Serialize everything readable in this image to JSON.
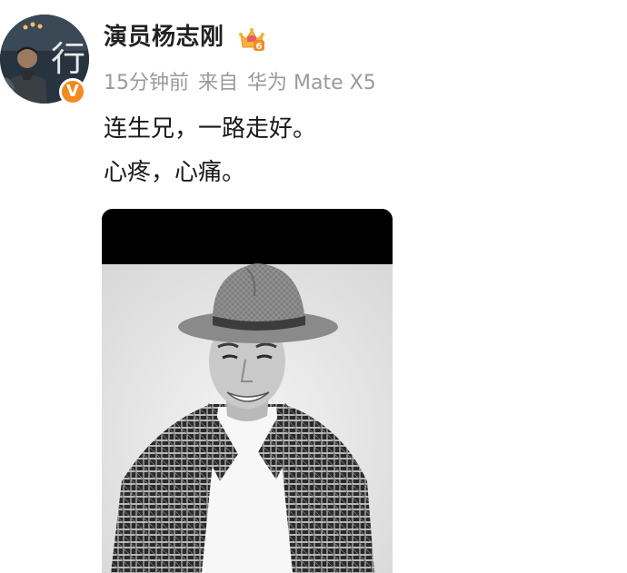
{
  "post": {
    "author": "演员杨志刚",
    "time": "15分钟前",
    "source_prefix": "来自",
    "device": "华为 Mate X5",
    "lines": [
      "连生兄，一路走好。",
      "心疼，心痛。"
    ]
  },
  "badges": {
    "verified_icon": "v-verified-icon",
    "verified_symbol": "V",
    "level_icon": "crown-level-icon",
    "level_number": "6",
    "verified_color": "#f28a1d",
    "level_color": "#f5b23c"
  },
  "avatar_calligraphy": "行"
}
